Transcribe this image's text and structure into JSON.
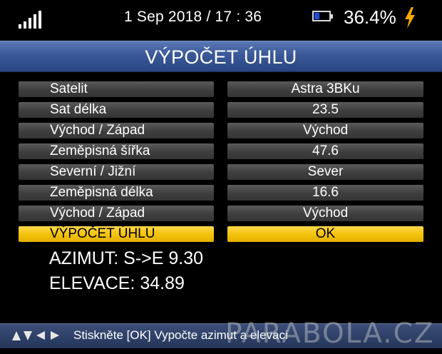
{
  "status_bar": {
    "datetime": "1 Sep 2018 / 17 : 36",
    "battery_percent": "36.4%",
    "battery_level": 0.364,
    "signal_bars": 5,
    "icons": [
      "signal-strength-icon",
      "battery-icon",
      "charging-bolt-icon"
    ]
  },
  "title": "VÝPOČET ÚHLU",
  "rows": [
    {
      "label": "Satelit",
      "value": "Astra 3BKu"
    },
    {
      "label": "Sat délka",
      "value": "23.5"
    },
    {
      "label": "Východ / Západ",
      "value": "Východ"
    },
    {
      "label": "Zeměpisná šířka",
      "value": "47.6"
    },
    {
      "label": "Severní / Jižní",
      "value": "Sever"
    },
    {
      "label": "Zeměpisná délka",
      "value": "16.6"
    },
    {
      "label": "Východ / Západ",
      "value": "Východ"
    },
    {
      "label": "VÝPOČET ÚHLU",
      "value": "OK",
      "selected": true
    }
  ],
  "results": {
    "azimuth": "AZIMUT: S->E 9.30",
    "elevation": "ELEVACE: 34.89"
  },
  "hint": "Stiskněte [OK] Vypočte azimut a elevaci",
  "watermark": "PARABOLA.CZ",
  "colors": {
    "title_bar": "#3a5898",
    "row_bg": "#454545",
    "selected_bg": "#f2c20a",
    "battery_fill": "#1f4dd6",
    "bolt": "#f5a800"
  }
}
